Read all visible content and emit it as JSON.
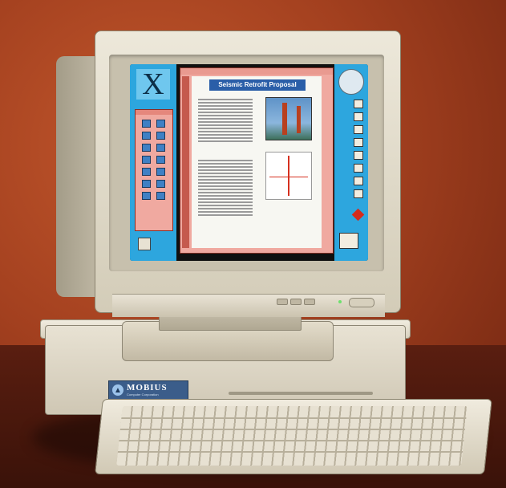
{
  "brand": {
    "name": "MOBIUS",
    "subtitle": "Computer Corporation"
  },
  "screen": {
    "document_title": "Seismic Retrofit Proposal",
    "logo_glyph": "X"
  },
  "colors": {
    "background": "#a3401f",
    "dock": "#2da6de",
    "window": "#f0a9a0",
    "heading": "#2a5ea8"
  }
}
